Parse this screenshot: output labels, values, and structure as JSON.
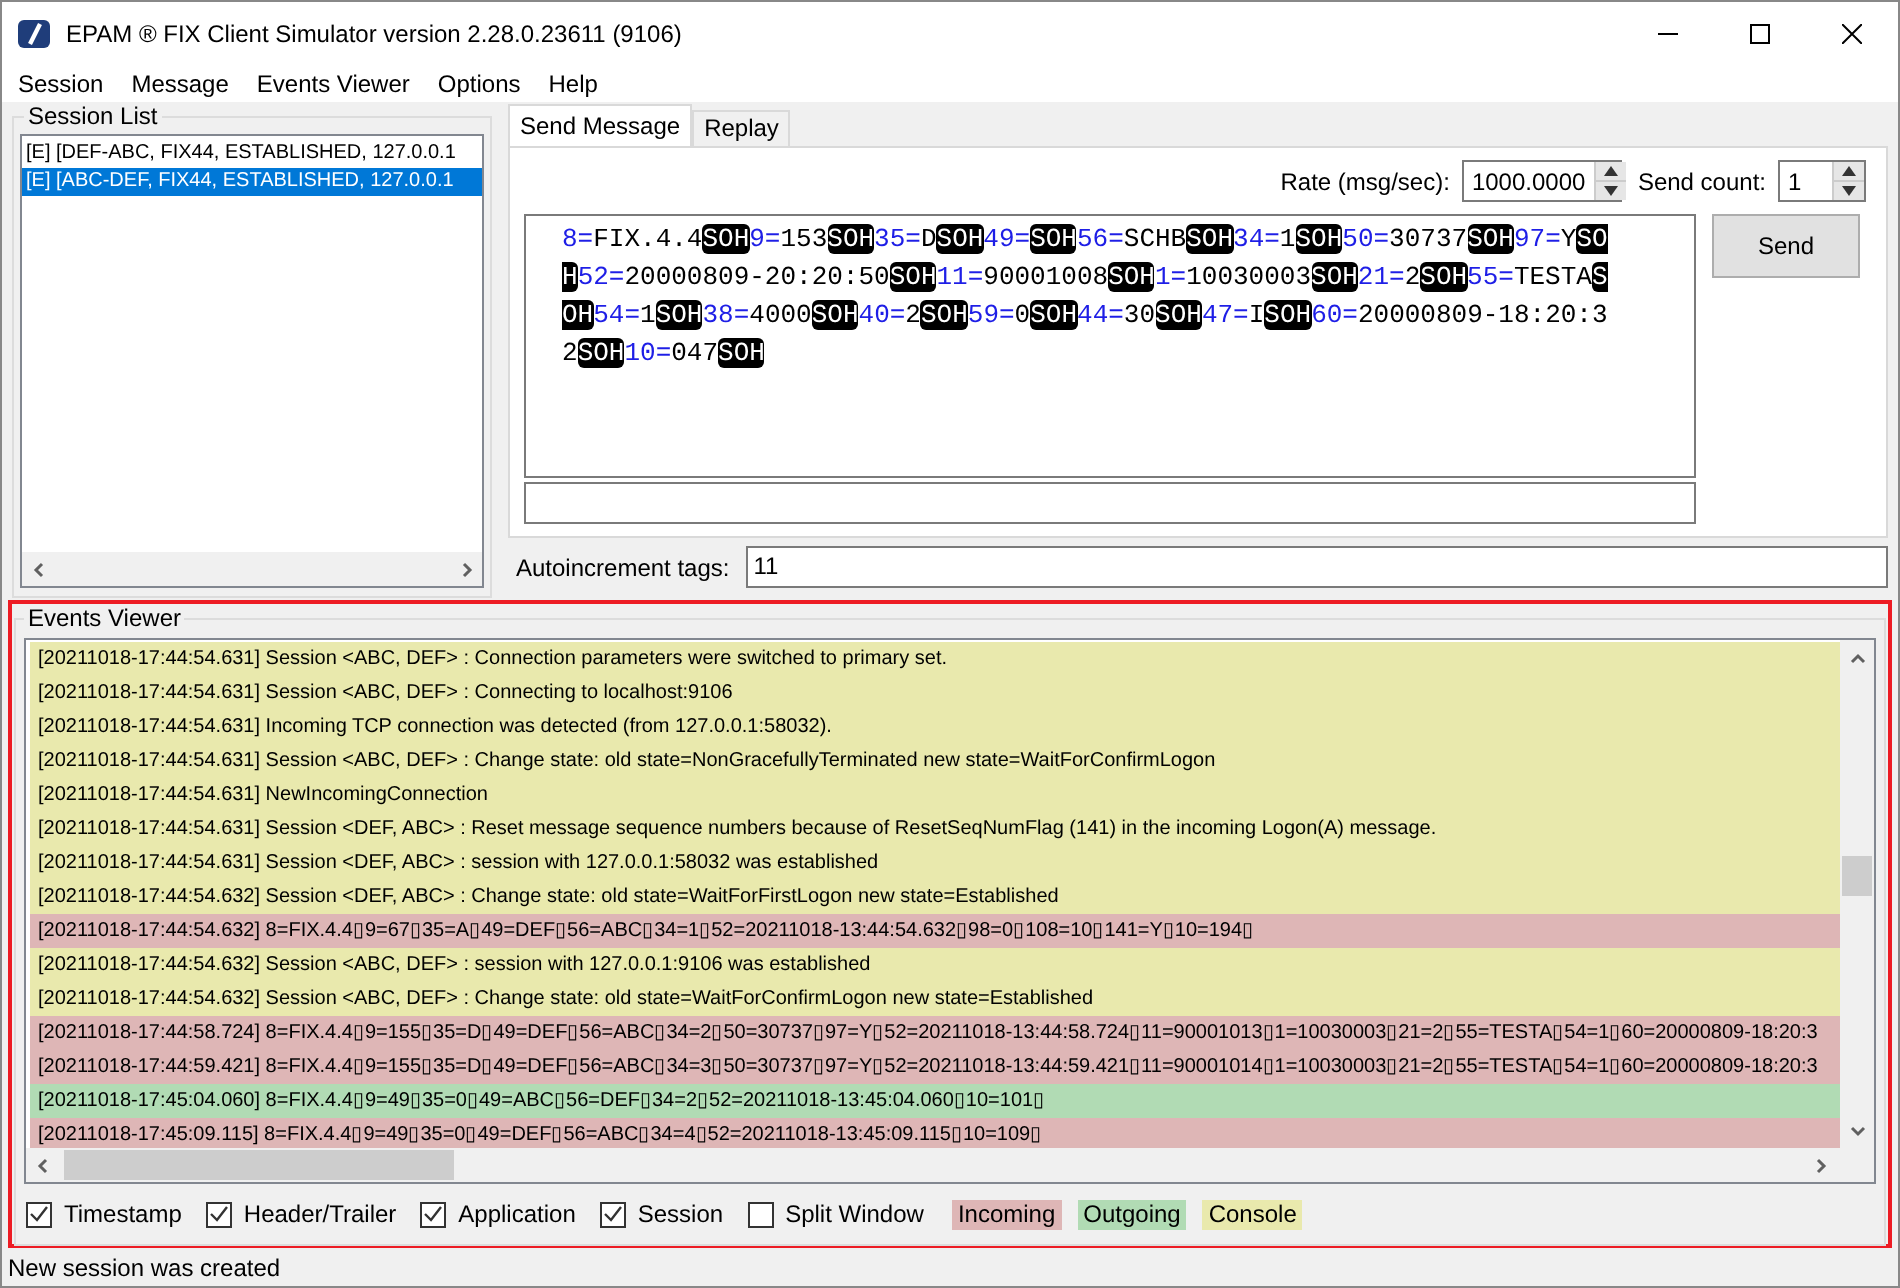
{
  "window": {
    "title": "EPAM ® FIX Client Simulator version 2.28.0.23611 (9106)"
  },
  "menu": [
    "Session",
    "Message",
    "Events Viewer",
    "Options",
    "Help"
  ],
  "session_list": {
    "title": "Session List",
    "items": [
      {
        "label": "[E] [DEF-ABC, FIX44, ESTABLISHED, 127.0.0.1",
        "selected": false
      },
      {
        "label": "[E] [ABC-DEF, FIX44, ESTABLISHED, 127.0.0.1",
        "selected": true
      }
    ]
  },
  "tabs": [
    {
      "label": "Send Message",
      "selected": true
    },
    {
      "label": "Replay",
      "selected": false
    }
  ],
  "send": {
    "rate_label": "Rate (msg/sec):",
    "rate": "1000.0000",
    "count_label": "Send count:",
    "count": "1",
    "button": "Send",
    "fields": [
      {
        "tag": "8=",
        "value": "FIX.4.4",
        "separator": "SOH"
      },
      {
        "tag": "9=",
        "value": "153",
        "separator": "SOH"
      },
      {
        "tag": "35=",
        "value": "D",
        "separator": "SOH"
      },
      {
        "tag": "49=",
        "separator": "SOH"
      },
      {
        "tag": "56=",
        "value": "SCHB",
        "separator": "SOH"
      },
      {
        "tag": "34=",
        "value": "1",
        "separator": "SOH"
      },
      {
        "tag": "50=",
        "value": "30737",
        "separator": "SOH"
      },
      {
        "tag": "97=",
        "value": "Y",
        "separator": "SOH"
      },
      {
        "tag": "52=",
        "value": "20000809-20:20:50",
        "separator": "SOH"
      },
      {
        "tag": "11=",
        "value": "90001008",
        "separator": "SOH"
      },
      {
        "tag": "1=",
        "value": "10030003",
        "separator": "SOH"
      },
      {
        "tag": "21=",
        "value": "2",
        "separator": "SOH"
      },
      {
        "tag": "55=",
        "value": "TESTA",
        "separator": "SOH"
      },
      {
        "tag": "54=",
        "value": "1",
        "separator": "SOH"
      },
      {
        "tag": "38=",
        "value": "4000",
        "separator": "SOH"
      },
      {
        "tag": "40=",
        "value": "2",
        "separator": "SOH"
      },
      {
        "tag": "59=",
        "value": "0",
        "separator": "SOH"
      },
      {
        "tag": "44=",
        "value": "30",
        "separator": "SOH"
      },
      {
        "tag": "47=",
        "value": "I",
        "separator": "SOH"
      },
      {
        "tag": "60=",
        "value": "20000809-18:20:32",
        "separator": "SOH"
      },
      {
        "tag": "10=",
        "value": "047",
        "separator": "SOH"
      }
    ],
    "autoincrement_label": "Autoincrement tags:",
    "autoincrement": "11"
  },
  "events": {
    "title": "Events Viewer",
    "lines": [
      {
        "kind": "console",
        "text": "[20211018-17:44:54.631] Session <ABC, DEF> : Connection parameters were switched to primary set."
      },
      {
        "kind": "console",
        "text": "[20211018-17:44:54.631] Session <ABC, DEF> : Connecting to localhost:9106"
      },
      {
        "kind": "console",
        "text": "[20211018-17:44:54.631] Incoming TCP connection was detected (from 127.0.0.1:58032)."
      },
      {
        "kind": "console",
        "text": "[20211018-17:44:54.631] Session <ABC, DEF> :  Change state: old state=NonGracefullyTerminated new state=WaitForConfirmLogon"
      },
      {
        "kind": "console",
        "text": "[20211018-17:44:54.631] NewIncomingConnection"
      },
      {
        "kind": "console",
        "text": "[20211018-17:44:54.631] Session <DEF, ABC> : Reset message sequence numbers because of ResetSeqNumFlag (141) in the incoming Logon(A) message."
      },
      {
        "kind": "console",
        "text": "[20211018-17:44:54.631] Session <DEF, ABC> : session with 127.0.0.1:58032 was established"
      },
      {
        "kind": "console",
        "text": "[20211018-17:44:54.632] Session <DEF, ABC> :  Change state: old state=WaitForFirstLogon new state=Established"
      },
      {
        "kind": "incoming",
        "text": "[20211018-17:44:54.632] 8=FIX.4.4▯9=67▯35=A▯49=DEF▯56=ABC▯34=1▯52=20211018-13:44:54.632▯98=0▯108=10▯141=Y▯10=194▯"
      },
      {
        "kind": "console",
        "text": "[20211018-17:44:54.632] Session <ABC, DEF> : session with 127.0.0.1:9106 was established"
      },
      {
        "kind": "console",
        "text": "[20211018-17:44:54.632] Session <ABC, DEF> :  Change state: old state=WaitForConfirmLogon new state=Established"
      },
      {
        "kind": "incoming",
        "text": "[20211018-17:44:58.724] 8=FIX.4.4▯9=155▯35=D▯49=DEF▯56=ABC▯34=2▯50=30737▯97=Y▯52=20211018-13:44:58.724▯11=90001013▯1=10030003▯21=2▯55=TESTA▯54=1▯60=20000809-18:20:3"
      },
      {
        "kind": "incoming",
        "text": "[20211018-17:44:59.421] 8=FIX.4.4▯9=155▯35=D▯49=DEF▯56=ABC▯34=3▯50=30737▯97=Y▯52=20211018-13:44:59.421▯11=90001014▯1=10030003▯21=2▯55=TESTA▯54=1▯60=20000809-18:20:3"
      },
      {
        "kind": "outgoing",
        "text": "[20211018-17:45:04.060] 8=FIX.4.4▯9=49▯35=0▯49=ABC▯56=DEF▯34=2▯52=20211018-13:45:04.060▯10=101▯"
      },
      {
        "kind": "incoming",
        "text": "[20211018-17:45:09.115] 8=FIX.4.4▯9=49▯35=0▯49=DEF▯56=ABC▯34=4▯52=20211018-13:45:09.115▯10=109▯"
      }
    ],
    "filters": [
      {
        "label": "Timestamp",
        "checked": true
      },
      {
        "label": "Header/Trailer",
        "checked": true
      },
      {
        "label": "Application",
        "checked": true
      },
      {
        "label": "Session",
        "checked": true
      },
      {
        "label": "Split Window",
        "checked": false
      }
    ],
    "legend": [
      {
        "kind": "incoming",
        "label": "Incoming"
      },
      {
        "kind": "outgoing",
        "label": "Outgoing"
      },
      {
        "kind": "console",
        "label": "Console"
      }
    ]
  },
  "status_bar": "New session was created"
}
